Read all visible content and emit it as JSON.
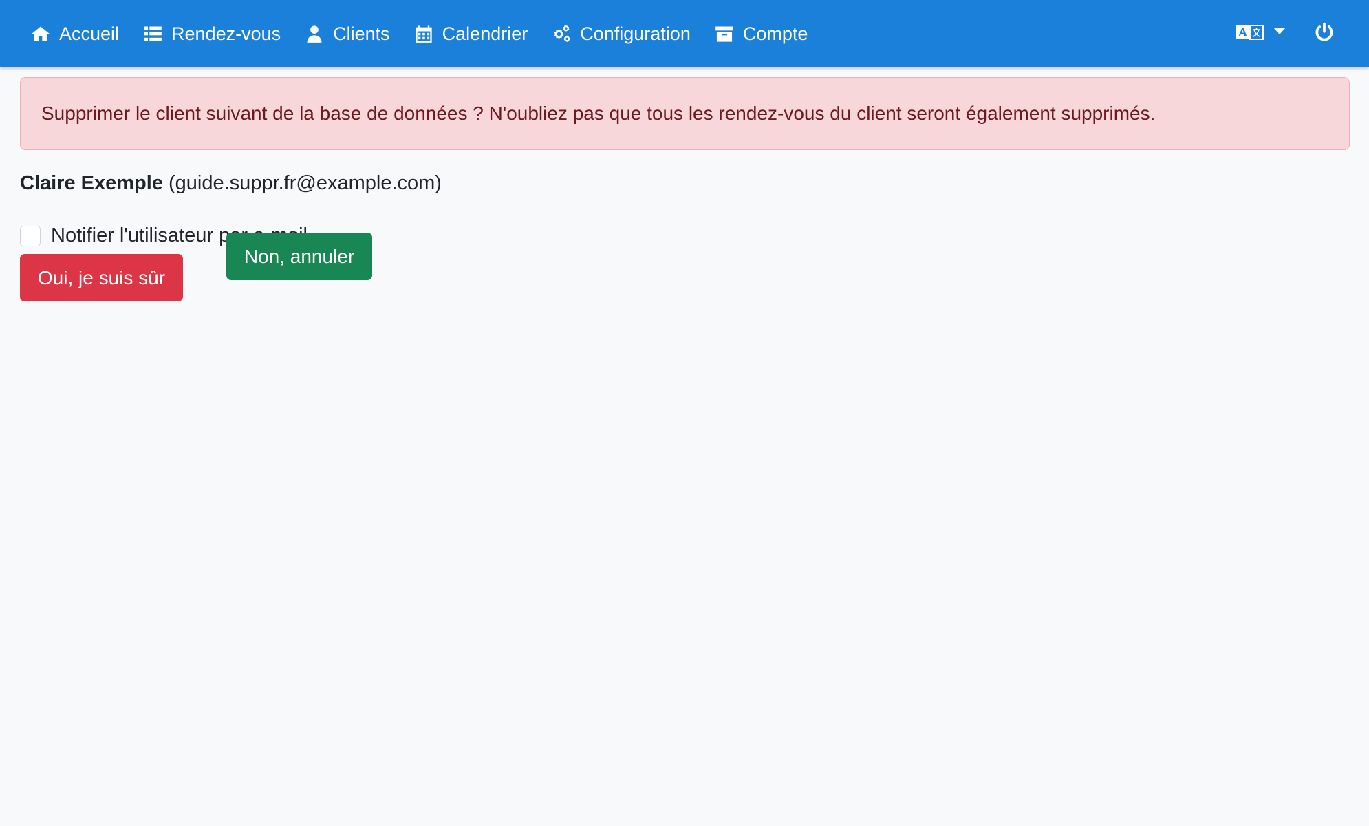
{
  "nav": {
    "items": [
      {
        "label": "Accueil",
        "icon": "home-icon"
      },
      {
        "label": "Rendez-vous",
        "icon": "list-icon"
      },
      {
        "label": "Clients",
        "icon": "user-icon"
      },
      {
        "label": "Calendrier",
        "icon": "calendar-icon"
      },
      {
        "label": "Configuration",
        "icon": "gears-icon"
      },
      {
        "label": "Compte",
        "icon": "archive-icon"
      }
    ],
    "language_icon": "language-icon",
    "power_icon": "power-icon"
  },
  "alert": {
    "message": "Supprimer le client suivant de la base de données ? N'oubliez pas que tous les rendez-vous du client seront également supprimés."
  },
  "client": {
    "name": "Claire Exemple",
    "email": "(guide.suppr.fr@example.com)"
  },
  "notify": {
    "label": "Notifier l'utilisateur par e-mail",
    "checked": false
  },
  "buttons": {
    "confirm": "Oui, je suis sûr",
    "cancel": "Non, annuler"
  },
  "colors": {
    "navbar": "#1a80da",
    "alert_bg": "#f8d7da",
    "danger": "#dc3545",
    "success": "#198754"
  }
}
